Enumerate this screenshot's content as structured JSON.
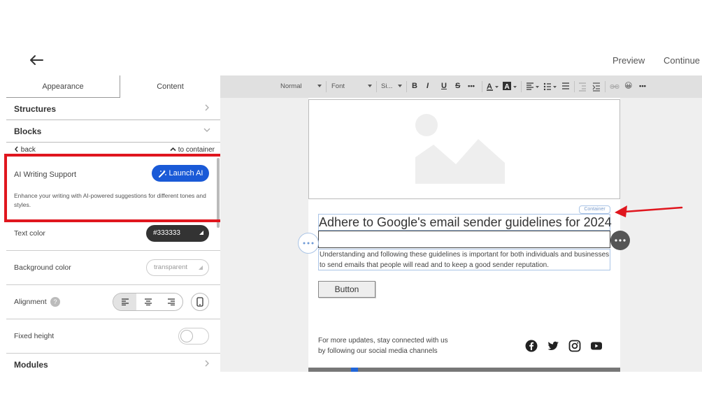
{
  "topbar": {
    "preview_label": "Preview",
    "continue_label": "Continue"
  },
  "left_panel": {
    "tabs": [
      {
        "label": "Appearance"
      },
      {
        "label": "Content"
      }
    ],
    "structures_label": "Structures",
    "blocks_label": "Blocks",
    "back_label": "back",
    "to_container_label": "to container",
    "ai": {
      "title": "AI Writing Support",
      "button_label": "Launch AI",
      "description": "Enhance your writing with AI-powered suggestions for different tones and styles."
    },
    "text_color": {
      "label": "Text color",
      "value": "#333333"
    },
    "background_color": {
      "label": "Background color",
      "value": "transparent"
    },
    "alignment": {
      "label": "Alignment",
      "help": "?"
    },
    "fixed_height": {
      "label": "Fixed height",
      "enabled": false
    },
    "modules_label": "Modules"
  },
  "toolbar": {
    "format": "Normal",
    "font": "Font",
    "size": "Si...",
    "bold": "B",
    "italic": "I",
    "underline": "U",
    "strike": "S",
    "more": "•••",
    "emoji": "😀"
  },
  "email": {
    "container_tag": "Container",
    "heading": "Adhere to Google's email sender guidelines for 2024",
    "body": "Understanding and following these guidelines is important for both individuals and businesses to send emails that people will read and to keep a good sender reputation.",
    "button_label": "Button",
    "footer_line1": "For more updates, stay connected with us",
    "footer_line2": "by following our social media channels"
  },
  "colors": {
    "accent": "#1a5ad7",
    "highlight": "#e0161e",
    "selection": "#aac4e6"
  }
}
